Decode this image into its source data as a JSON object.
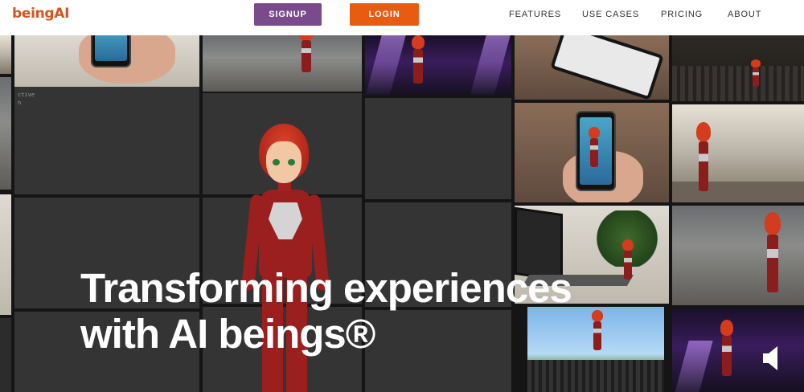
{
  "header": {
    "logo": "beingAI",
    "signup_label": "SIGNUP",
    "login_label": "LOGIN",
    "menu": [
      {
        "label": "FEATURES"
      },
      {
        "label": "USE CASES"
      },
      {
        "label": "PRICING"
      },
      {
        "label": "ABOUT"
      }
    ]
  },
  "hero": {
    "headline_line1": "Transforming experiences",
    "headline_line2": "with AI beings®",
    "side_text_1": "ctive",
    "side_text_2": "n",
    "sound_icon": "speaker-icon"
  },
  "colors": {
    "brand_orange": "#e85c11",
    "signup_purple": "#7a4a8c",
    "logo_orange": "#d2551e"
  }
}
